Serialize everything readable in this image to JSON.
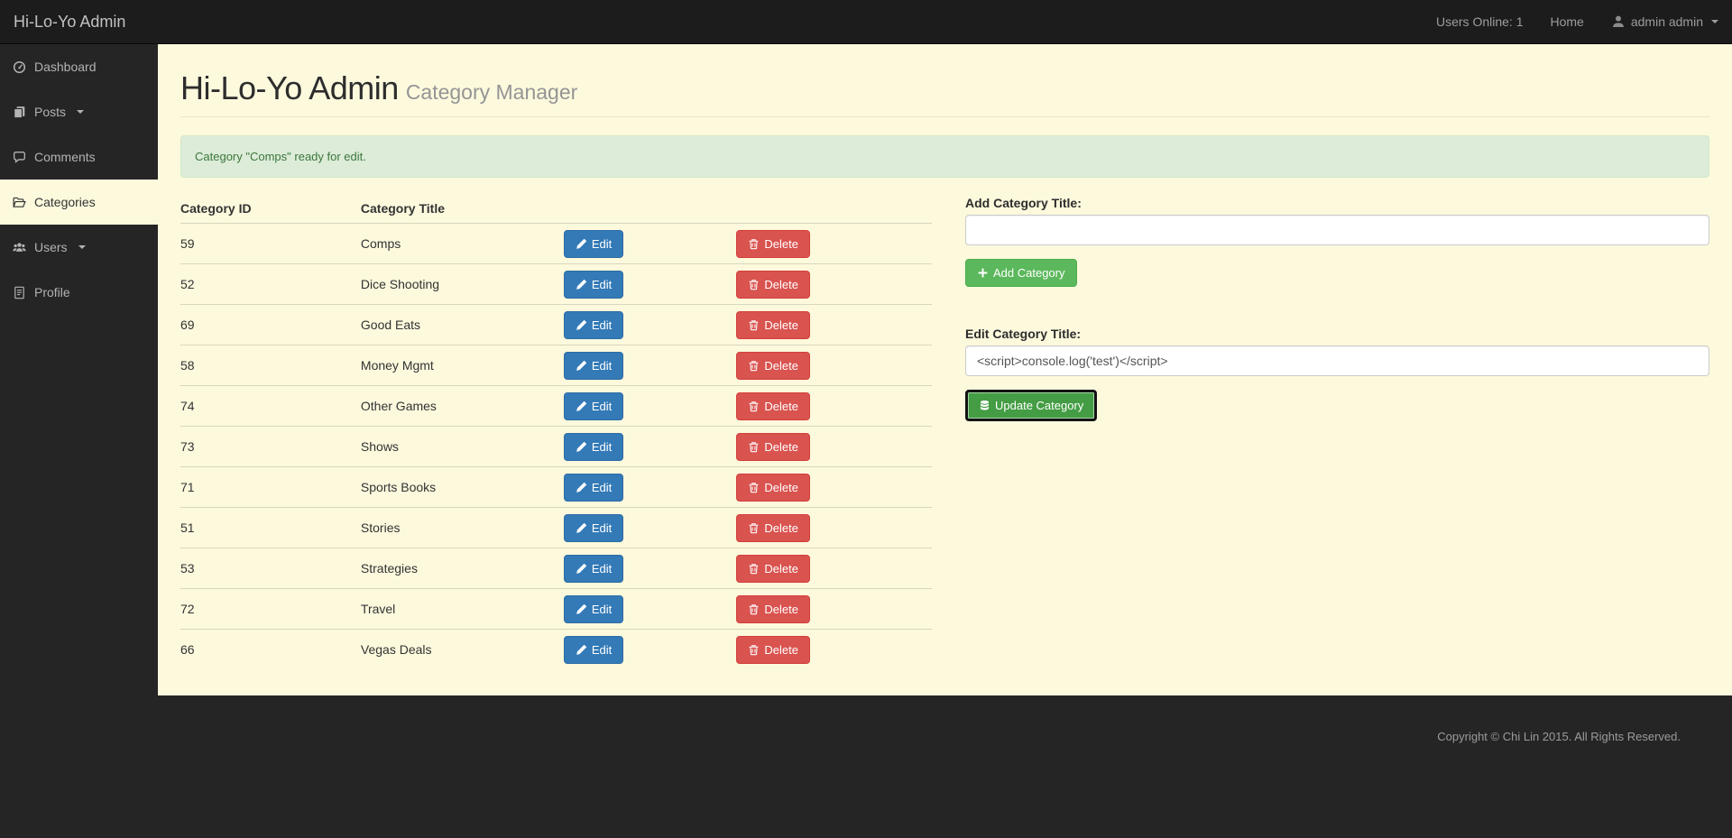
{
  "navbar": {
    "brand": "Hi-Lo-Yo Admin",
    "users_online": "Users Online: 1",
    "home": "Home",
    "user_menu": "admin admin"
  },
  "sidebar": {
    "items": [
      {
        "label": "Dashboard",
        "icon": "dashboard-icon",
        "active": false
      },
      {
        "label": "Posts",
        "icon": "posts-icon",
        "active": false,
        "has_submenu": true
      },
      {
        "label": "Comments",
        "icon": "comments-icon",
        "active": false
      },
      {
        "label": "Categories",
        "icon": "categories-icon",
        "active": true
      },
      {
        "label": "Users",
        "icon": "users-icon",
        "active": false,
        "has_submenu": true
      },
      {
        "label": "Profile",
        "icon": "profile-icon",
        "active": false
      }
    ]
  },
  "page": {
    "title": "Hi-Lo-Yo Admin",
    "subtitle": "Category Manager"
  },
  "alert": {
    "message": "Category \"Comps\" ready for edit."
  },
  "table": {
    "headers": [
      "Category ID",
      "Category Title"
    ],
    "edit_label": "Edit",
    "delete_label": "Delete",
    "rows": [
      {
        "id": "59",
        "title": "Comps"
      },
      {
        "id": "52",
        "title": "Dice Shooting"
      },
      {
        "id": "69",
        "title": "Good Eats"
      },
      {
        "id": "58",
        "title": "Money Mgmt"
      },
      {
        "id": "74",
        "title": "Other Games"
      },
      {
        "id": "73",
        "title": "Shows"
      },
      {
        "id": "71",
        "title": "Sports Books"
      },
      {
        "id": "51",
        "title": "Stories"
      },
      {
        "id": "53",
        "title": "Strategies"
      },
      {
        "id": "72",
        "title": "Travel"
      },
      {
        "id": "66",
        "title": "Vegas Deals"
      }
    ]
  },
  "forms": {
    "add": {
      "label": "Add Category Title:",
      "value": "",
      "button": "Add Category"
    },
    "edit": {
      "label": "Edit Category Title:",
      "value": "<script>console.log('test')</script>",
      "button": "Update Category"
    }
  },
  "footer": {
    "copyright": "Copyright © Chi Lin 2015. All Rights Reserved."
  },
  "colors": {
    "navbar_bg": "#1c1c1c",
    "body_dark": "#252525",
    "content_bg": "#fcf9dd",
    "alert_bg": "#dcecd8",
    "alert_text": "#3c763d",
    "primary_blue": "#337ab7",
    "danger_red": "#d9534f",
    "success_green": "#5cb85c",
    "success_green_active": "#449d44"
  }
}
